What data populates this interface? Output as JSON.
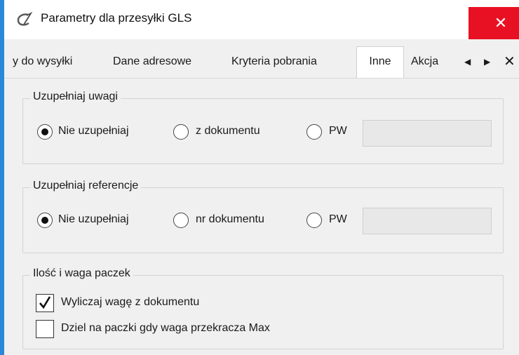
{
  "window": {
    "title": "Parametry dla przesyłki GLS",
    "close_glyph": "✕"
  },
  "tabs": [
    {
      "label": "y do wysyłki",
      "active": false
    },
    {
      "label": "Dane adresowe",
      "active": false
    },
    {
      "label": "Kryteria pobrania",
      "active": false
    },
    {
      "label": "Inne",
      "active": true
    },
    {
      "label": "Akcja",
      "active": false
    }
  ],
  "tab_nav": {
    "prev": "◀",
    "next": "▶",
    "close": "✕"
  },
  "groups": {
    "uwagi": {
      "title": "Uzupełniaj uwagi",
      "options": [
        "Nie uzupełniaj",
        "z dokumentu",
        "PW"
      ],
      "selected": 0,
      "pw_value": ""
    },
    "referencje": {
      "title": "Uzupełniaj referencje",
      "options": [
        "Nie uzupełniaj",
        "nr dokumentu",
        "PW"
      ],
      "selected": 0,
      "pw_value": ""
    },
    "paczki": {
      "title": "Ilość i waga paczek",
      "checkboxes": [
        {
          "label": "Wyliczaj wagę z dokumentu",
          "checked": true
        },
        {
          "label": "Dziel na paczki gdy waga przekracza Max",
          "checked": false
        }
      ]
    }
  },
  "colors": {
    "accent": "#2b88d8",
    "close": "#e81123",
    "background": "#f0f0f0"
  }
}
